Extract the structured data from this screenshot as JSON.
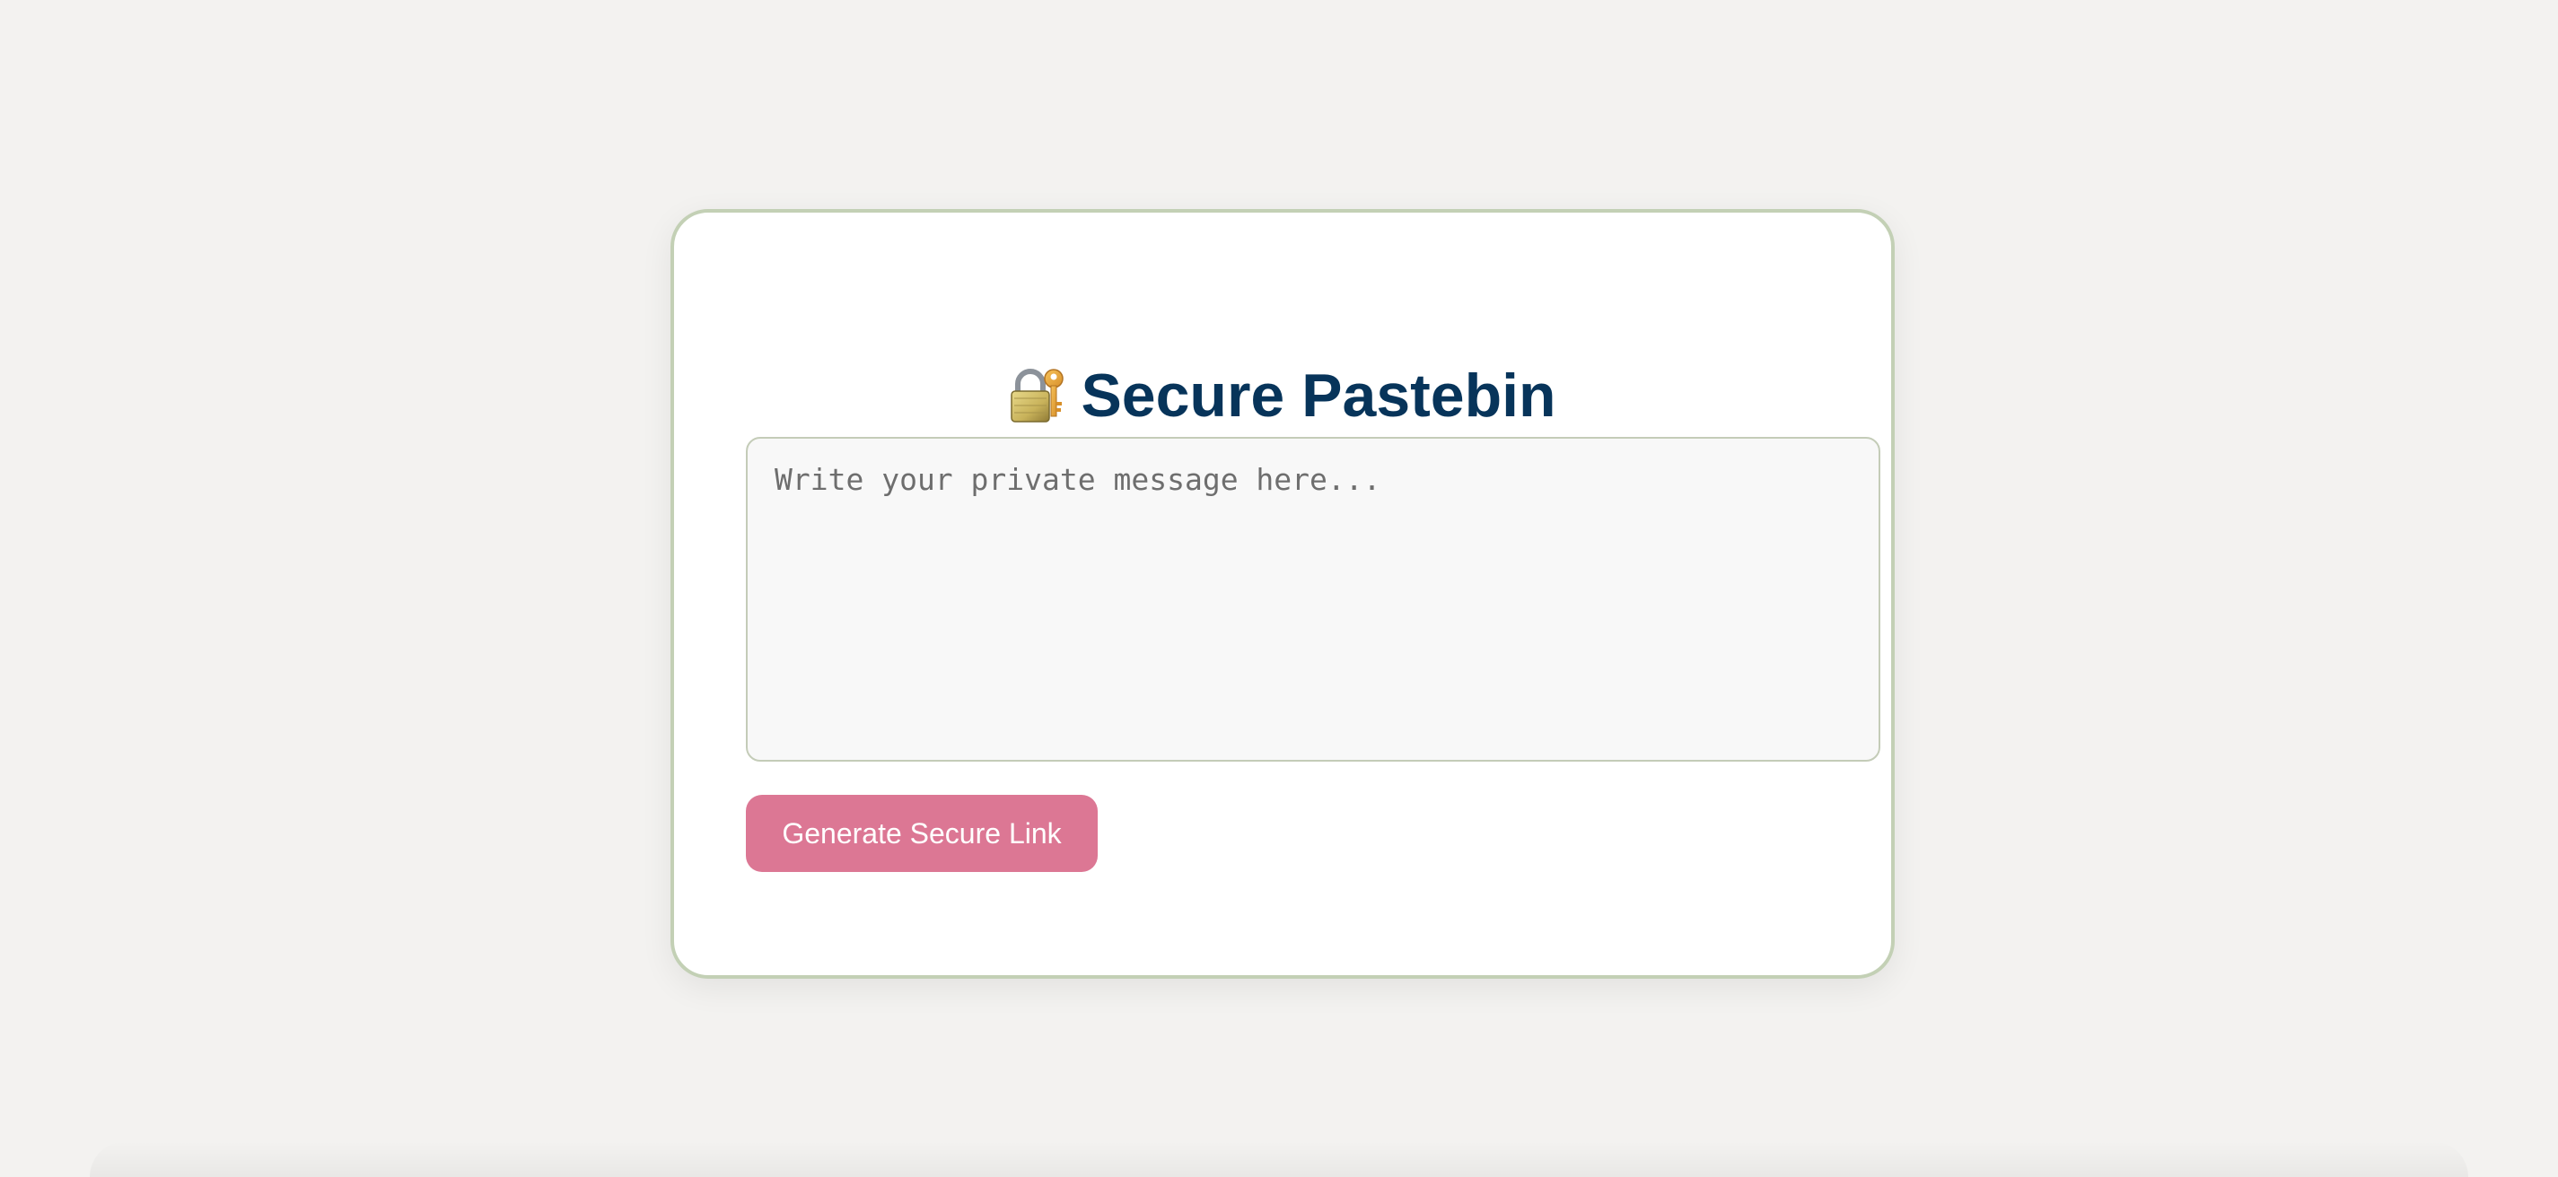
{
  "app": {
    "title": "Secure Pastebin",
    "title_icon": "lock-with-key-icon"
  },
  "editor": {
    "placeholder": "Write your private message here...",
    "value": ""
  },
  "actions": {
    "generate_label": "Generate Secure Link"
  },
  "colors": {
    "background": "#f3f2f0",
    "card_border": "#c3d0b5",
    "title": "#07345a",
    "button": "#dc7794",
    "button_text": "#ffffff"
  }
}
